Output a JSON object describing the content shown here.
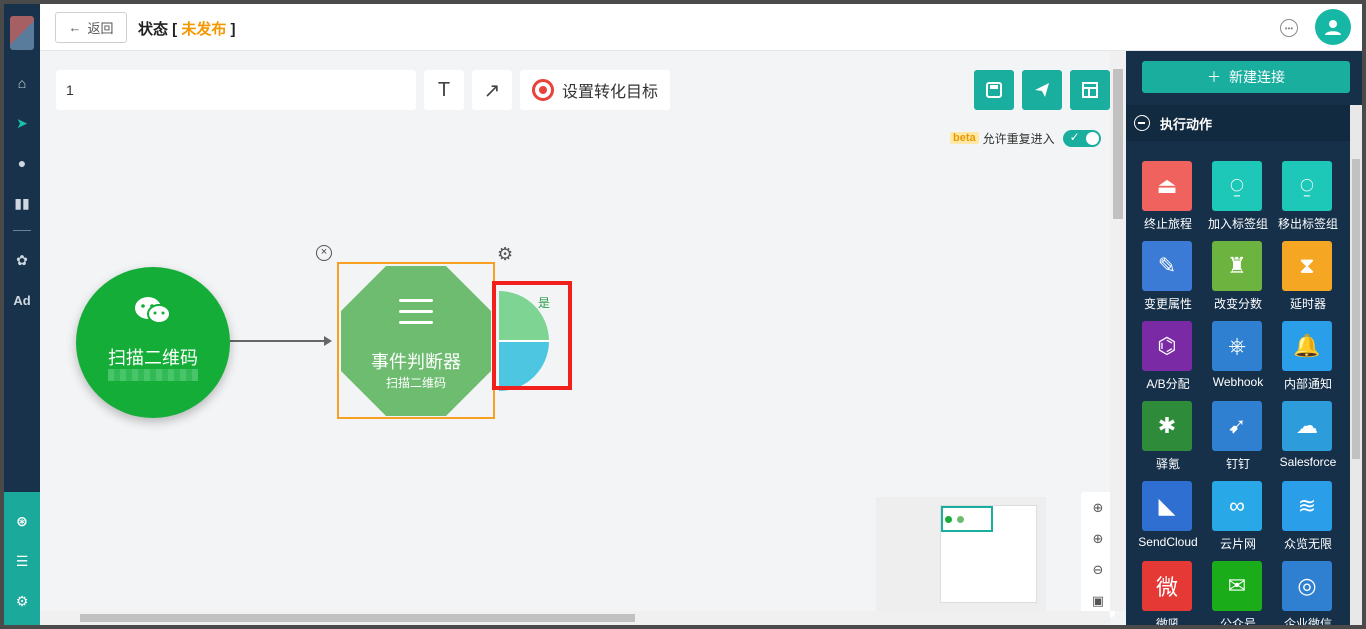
{
  "header": {
    "back_label": "返回",
    "status_prefix": "状态 [",
    "status_value": "未发布",
    "status_suffix": "]"
  },
  "toolbar": {
    "flow_name_value": "1",
    "text_tool_icon": "T",
    "arrow_tool_icon": "↗",
    "goal_label": "设置转化目标"
  },
  "canvas": {
    "beta_badge": "beta",
    "reentry_label": "允许重复进入",
    "reentry_enabled": true,
    "nodes": {
      "qr": {
        "title": "扫描二维码"
      },
      "event": {
        "title": "事件判断器",
        "subtitle": "扫描二维码"
      },
      "branch_yes": "是"
    }
  },
  "right_panel": {
    "new_connection": "新建连接",
    "section_title": "执行动作",
    "actions": [
      {
        "label": "终止旅程",
        "icon": "stop-icon",
        "color": "#f0625d"
      },
      {
        "label": "加入标签组",
        "icon": "user-plus-icon",
        "color": "#1ec8b8"
      },
      {
        "label": "移出标签组",
        "icon": "user-minus-icon",
        "color": "#1ec8b8"
      },
      {
        "label": "变更属性",
        "icon": "edit-icon",
        "color": "#3b7bd6"
      },
      {
        "label": "改变分数",
        "icon": "trophy-icon",
        "color": "#6cb43f"
      },
      {
        "label": "延时器",
        "icon": "hourglass-icon",
        "color": "#f5a623"
      },
      {
        "label": "A/B分配",
        "icon": "ab-split-icon",
        "color": "#7a2aa5"
      },
      {
        "label": "Webhook",
        "icon": "webhook-icon",
        "color": "#2f80d1"
      },
      {
        "label": "内部通知",
        "icon": "bell-icon",
        "color": "#2a9ee8"
      },
      {
        "label": "驿氪",
        "icon": "spider-icon",
        "color": "#2e8b3a"
      },
      {
        "label": "钉钉",
        "icon": "dingtalk-icon",
        "color": "#2f80d1"
      },
      {
        "label": "Salesforce",
        "icon": "cloud-icon",
        "color": "#2d9cdb"
      },
      {
        "label": "SendCloud",
        "icon": "sendcloud-icon",
        "color": "#2f6fd1"
      },
      {
        "label": "云片网",
        "icon": "yunpian-icon",
        "color": "#29a8e8"
      },
      {
        "label": "众览无限",
        "icon": "zl-icon",
        "color": "#2a9ee8"
      },
      {
        "label": "微吼",
        "icon": "vhall-icon",
        "color": "#e53935"
      },
      {
        "label": "公众号",
        "icon": "wechat-icon",
        "color": "#1aad19"
      },
      {
        "label": "企业微信",
        "icon": "work-wechat-icon",
        "color": "#2f80d1"
      }
    ]
  }
}
